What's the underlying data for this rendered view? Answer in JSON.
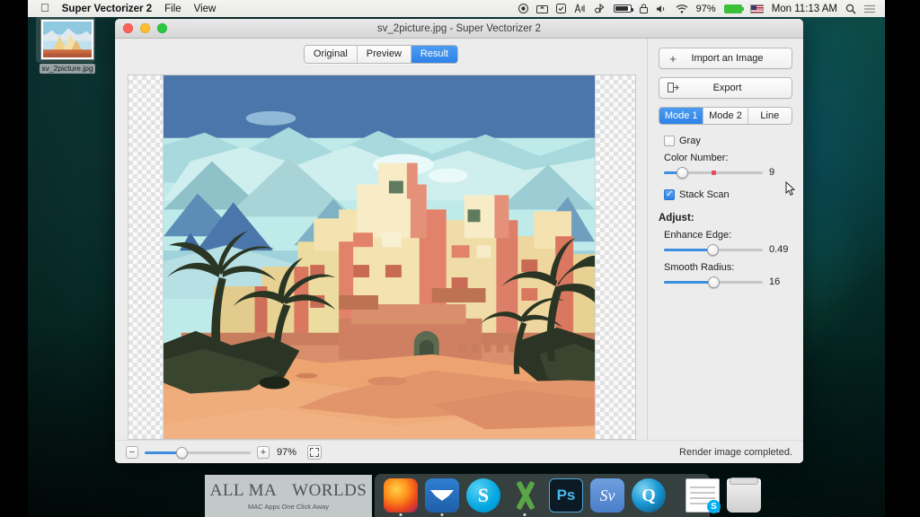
{
  "menubar": {
    "apple_icon": "apple-logo",
    "app_name": "Super Vectorizer 2",
    "items": [
      "File",
      "View"
    ],
    "status_icons": [
      "record-icon",
      "screenshot-icon",
      "checkmark-circle-icon",
      "soundwave-icon",
      "bluetooth-icon",
      "battery-gauge-icon",
      "lock-icon",
      "volume-icon",
      "wifi-icon"
    ],
    "battery_percent": "97%",
    "input_flag": "us-flag-icon",
    "clock": "Mon 11:13 AM",
    "search_icon": "search-icon",
    "notification_icon": "notification-center-icon"
  },
  "desktop": {
    "icon_label": "sv_2picture.jpg"
  },
  "window": {
    "title": "sv_2picture.jpg - Super Vectorizer 2",
    "traffic_lights": [
      "close",
      "minimize",
      "zoom"
    ],
    "tabs": [
      {
        "label": "Original",
        "selected": false
      },
      {
        "label": "Preview",
        "selected": false
      },
      {
        "label": "Result",
        "selected": true
      }
    ],
    "panel": {
      "import_button": {
        "label": "Import an Image",
        "icon": "plus-icon"
      },
      "export_button": {
        "label": "Export",
        "icon": "export-icon"
      },
      "modes": [
        {
          "label": "Mode 1",
          "selected": true
        },
        {
          "label": "Mode 2",
          "selected": false
        },
        {
          "label": "Line",
          "selected": false
        }
      ],
      "gray_checkbox": {
        "label": "Gray",
        "checked": false
      },
      "color_number": {
        "label": "Color Number:",
        "value": "9",
        "fill_percent": 18,
        "tick_percent": 50
      },
      "stack_scan_checkbox": {
        "label": "Stack Scan",
        "checked": true
      },
      "adjust_heading": "Adjust:",
      "enhance_edge": {
        "label": "Enhance Edge:",
        "value": "0.49",
        "fill_percent": 49
      },
      "smooth_radius": {
        "label": "Smooth Radius:",
        "value": "16",
        "fill_percent": 50
      }
    },
    "bottombar": {
      "zoom_out": "−",
      "zoom_in": "+",
      "zoom_percent": "97%",
      "zoom_fill_percent": 35,
      "fit_icon": "fit-to-screen-icon",
      "status": "Render image completed."
    }
  },
  "watermark": {
    "title_left": "ALL MA",
    "apple_glyph": "",
    "title_right": "WORLDS",
    "tagline": "MAC Apps One Click Away"
  },
  "dock": {
    "items": [
      {
        "name": "firefox",
        "label": "Firefox",
        "running": true
      },
      {
        "name": "thunderbird",
        "label": "Thunderbird",
        "running": true
      },
      {
        "name": "skype",
        "label": "Skype",
        "glyph": "S",
        "running": true
      },
      {
        "name": "excel",
        "label": "Excel",
        "running": true
      },
      {
        "name": "photoshop",
        "label": "Photoshop",
        "glyph": "Ps",
        "running": true
      },
      {
        "name": "super-vectorizer",
        "label": "Super Vectorizer",
        "glyph": "Sv",
        "running": true
      },
      {
        "name": "quicktime",
        "label": "QuickTime",
        "glyph": "Q",
        "running": true
      },
      {
        "name": "document",
        "label": "Skype Document",
        "glyph": "S",
        "running": false
      },
      {
        "name": "trash",
        "label": "Trash",
        "running": false
      }
    ]
  },
  "colors": {
    "accent": "#2f83e8",
    "tick": "#e8495e",
    "window_bg": "#ececec",
    "desktop": "#0c4a45"
  }
}
